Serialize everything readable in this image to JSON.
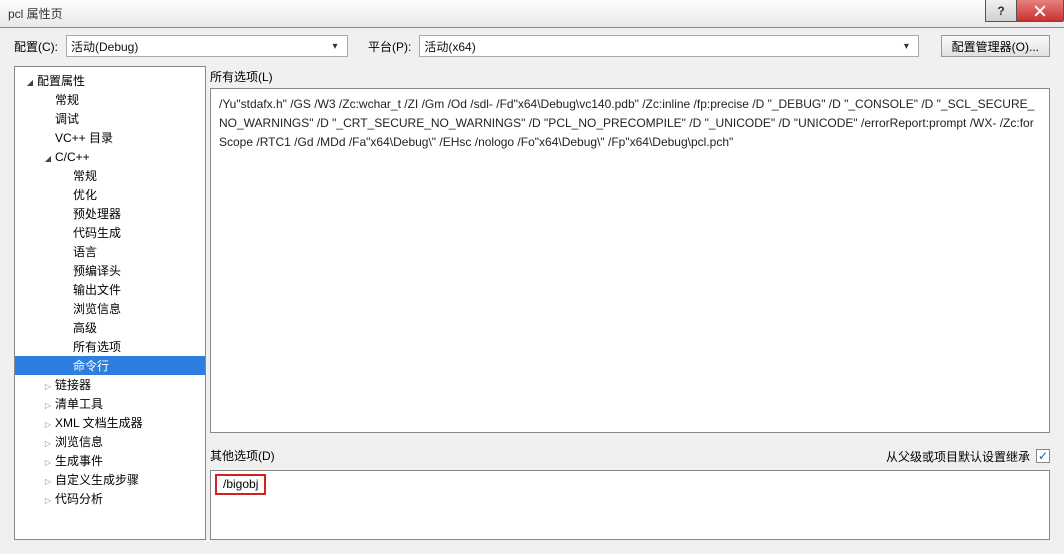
{
  "window": {
    "title": "pcl 属性页"
  },
  "toolbar": {
    "config_label": "配置(C):",
    "config_value": "活动(Debug)",
    "platform_label": "平台(P):",
    "platform_value": "活动(x64)",
    "manager_button": "配置管理器(O)..."
  },
  "tree": {
    "root": "配置属性",
    "items_l2": [
      "常规",
      "调试",
      "VC++ 目录"
    ],
    "cxx": "C/C++",
    "cxx_children": [
      "常规",
      "优化",
      "预处理器",
      "代码生成",
      "语言",
      "预编译头",
      "输出文件",
      "浏览信息",
      "高级",
      "所有选项",
      "命令行"
    ],
    "collapsed": [
      "链接器",
      "清单工具",
      "XML 文档生成器",
      "浏览信息",
      "生成事件",
      "自定义生成步骤",
      "代码分析"
    ]
  },
  "right": {
    "all_options_label": "所有选项(L)",
    "all_options_value": "/Yu\"stdafx.h\" /GS /W3 /Zc:wchar_t /ZI /Gm /Od /sdl- /Fd\"x64\\Debug\\vc140.pdb\" /Zc:inline /fp:precise /D \"_DEBUG\" /D \"_CONSOLE\" /D \"_SCL_SECURE_NO_WARNINGS\" /D \"_CRT_SECURE_NO_WARNINGS\" /D \"PCL_NO_PRECOMPILE\" /D \"_UNICODE\" /D \"UNICODE\" /errorReport:prompt /WX- /Zc:forScope /RTC1 /Gd /MDd /Fa\"x64\\Debug\\\" /EHsc /nologo /Fo\"x64\\Debug\\\" /Fp\"x64\\Debug\\pcl.pch\"",
    "other_label": "其他选项(D)",
    "inherit_label": "从父级或项目默认设置继承",
    "inherit_checked": "✓",
    "other_value": "/bigobj"
  }
}
